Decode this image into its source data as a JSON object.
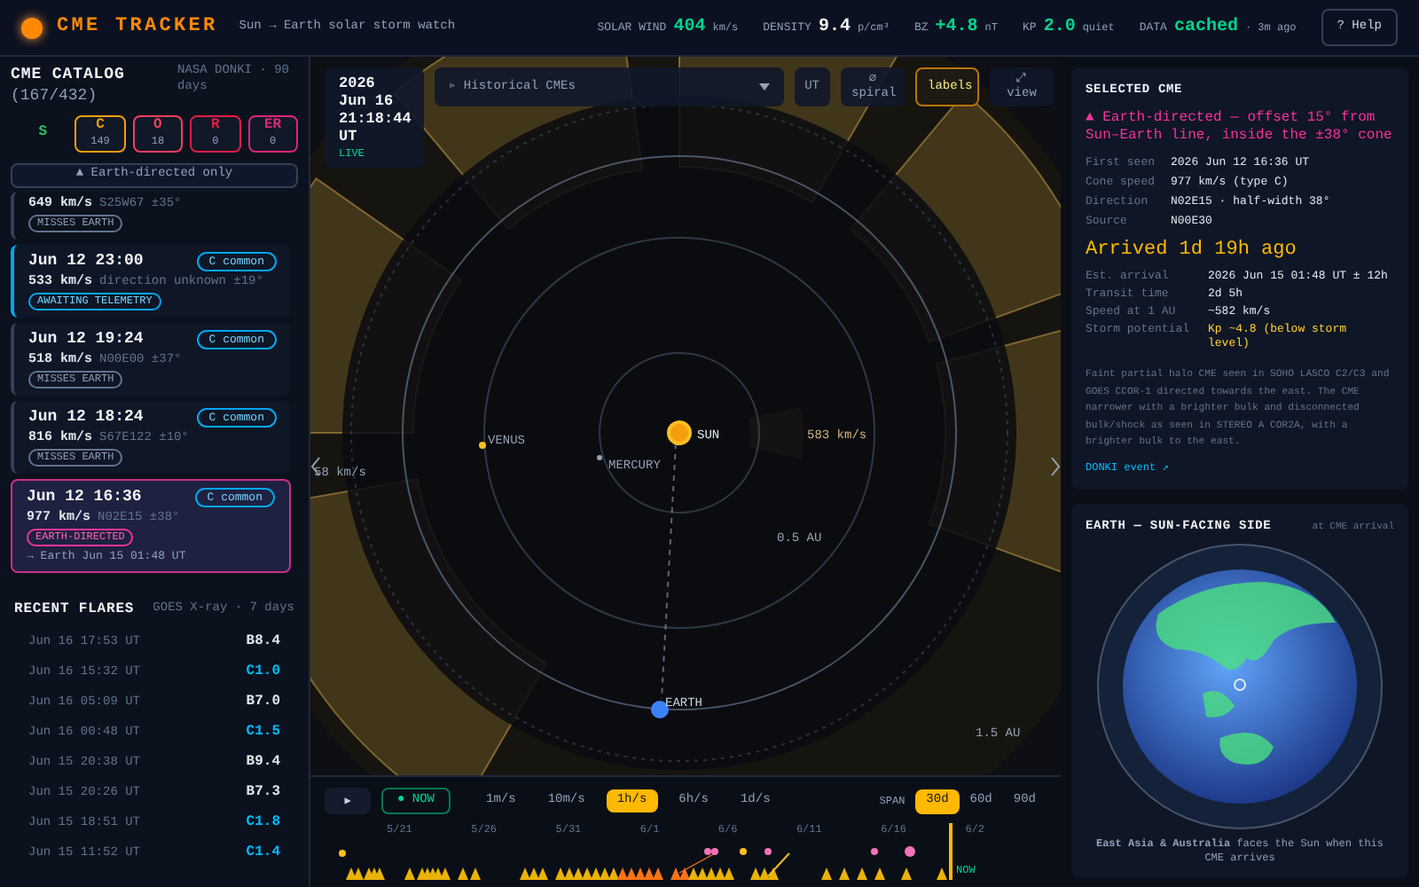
{
  "header": {
    "title": "CME TRACKER",
    "subtitle": "Sun → Earth solar storm watch",
    "stats": [
      {
        "label": "SOLAR WIND",
        "value": "404",
        "unit": "km/s",
        "kind": "good"
      },
      {
        "label": "DENSITY",
        "value": "9.4",
        "unit": "p/cm³",
        "kind": "plain"
      },
      {
        "label": "BZ",
        "value": "+4.8",
        "unit": "nT",
        "kind": "good"
      },
      {
        "label": "KP",
        "value": "2.0",
        "unit": "quiet",
        "kind": "good"
      },
      {
        "label": "DATA",
        "value": "cached",
        "unit": "· 3m ago",
        "kind": "good"
      }
    ],
    "help": "? Help"
  },
  "catalog": {
    "title": "CME CATALOG",
    "count": "(167/432)",
    "source": "NASA DONKI · 90 days",
    "filters": [
      {
        "letter": "S",
        "on": false,
        "color": "#22c55e"
      },
      {
        "letter": "C",
        "count": "149",
        "on": true,
        "color": "#f59e0b"
      },
      {
        "letter": "O",
        "count": "18",
        "on": true,
        "color": "#f43f5e"
      },
      {
        "letter": "R",
        "count": "0",
        "on": true,
        "color": "#e11d48"
      },
      {
        "letter": "ER",
        "count": "0",
        "on": true,
        "color": "#db2777"
      }
    ],
    "earth_only": {
      "label": "▲ Earth-directed only",
      "on": false
    },
    "items": [
      {
        "speed": "649 km/s",
        "direction": "S25W67 ±35°",
        "status": "MISSES EARTH",
        "kind": "misses",
        "selected": false
      },
      {
        "time": "Jun 12 23:00",
        "badge": "C common",
        "speed": "533 km/s",
        "direction": "direction unknown ±19°",
        "status": "AWAITING TELEMETRY",
        "kind": "awaiting",
        "selected": false
      },
      {
        "time": "Jun 12 19:24",
        "badge": "C common",
        "speed": "518 km/s",
        "direction": "N00E00 ±37°",
        "status": "MISSES EARTH",
        "kind": "misses",
        "selected": false
      },
      {
        "time": "Jun 12 18:24",
        "badge": "C common",
        "speed": "816 km/s",
        "direction": "S67E122 ±10°",
        "status": "MISSES EARTH",
        "kind": "misses",
        "selected": false
      },
      {
        "time": "Jun 12 16:36",
        "badge": "C common",
        "speed": "977 km/s",
        "direction": "N02E15 ±38°",
        "status": "EARTH-DIRECTED",
        "kind": "earth",
        "arrival": "→ Earth Jun 15 01:48 UT",
        "selected": true
      }
    ]
  },
  "flares": {
    "title": "RECENT FLARES",
    "source": "GOES X-ray · 7 days",
    "rows": [
      {
        "time": "Jun 16 17:53 UT",
        "class": "B8.4",
        "kind": "b"
      },
      {
        "time": "Jun 16 15:32 UT",
        "class": "C1.0",
        "kind": "c"
      },
      {
        "time": "Jun 16 05:09 UT",
        "class": "B7.0",
        "kind": "b"
      },
      {
        "time": "Jun 16 00:48 UT",
        "class": "C1.5",
        "kind": "c"
      },
      {
        "time": "Jun 15 20:38 UT",
        "class": "B9.4",
        "kind": "b"
      },
      {
        "time": "Jun 15 20:26 UT",
        "class": "B7.3",
        "kind": "b"
      },
      {
        "time": "Jun 15 18:51 UT",
        "class": "C1.8",
        "kind": "c"
      },
      {
        "time": "Jun 15 11:52 UT",
        "class": "C1.4",
        "kind": "c"
      }
    ]
  },
  "view": {
    "clock": "2026 Jun 16 21:18:44 UT",
    "live": "LIVE",
    "layer_select": "▹ Historical CMEs",
    "toggles": [
      {
        "label": "UT",
        "selected": false
      },
      {
        "label": "⌀ spiral",
        "selected": false
      },
      {
        "label": "labels",
        "selected": true
      },
      {
        "label": "⤢ view",
        "selected": false
      }
    ],
    "labels": [
      {
        "text": "SUN",
        "kind": "sun"
      },
      {
        "text": "VENUS",
        "kind": "venus"
      },
      {
        "text": "MERCURY",
        "kind": "mercury"
      },
      {
        "text": "EARTH",
        "kind": "earth"
      },
      {
        "text": "583 km/s",
        "kind": "speed"
      },
      {
        "text": "0.5 AU",
        "kind": "inner"
      },
      {
        "text": "1.5 AU",
        "kind": "outer"
      },
      {
        "text": "58 km/s",
        "kind": "edge"
      }
    ]
  },
  "playback": {
    "play": "▶",
    "now": "● NOW",
    "speeds": [
      {
        "label": "1m/s",
        "selected": false
      },
      {
        "label": "10m/s",
        "selected": false
      },
      {
        "label": "1h/s",
        "selected": true
      },
      {
        "label": "6h/s",
        "selected": false
      },
      {
        "label": "1d/s",
        "selected": false
      }
    ],
    "span_label": "SPAN",
    "spans": [
      {
        "label": "30d",
        "selected": true
      },
      {
        "label": "60d",
        "selected": false
      },
      {
        "label": "90d",
        "selected": false
      }
    ],
    "dates": [
      "5/21",
      "5/26",
      "5/31",
      "6/1",
      "6/6",
      "6/11",
      "6/16",
      "6/2"
    ],
    "now_label": "NOW"
  },
  "selected": {
    "title": "SELECTED CME",
    "alert": "▲ Earth-directed — offset 15° from Sun–Earth line, inside the ±38° cone",
    "facts": [
      {
        "label": "First seen",
        "value": "2026 Jun 12 16:36 UT"
      },
      {
        "label": "Cone speed",
        "value": "977 km/s (type C)"
      },
      {
        "label": "Direction",
        "value": "N02E15 · half-width 38°"
      },
      {
        "label": "Source",
        "value": "N00E30"
      }
    ],
    "arrived": "Arrived 1d 19h ago",
    "forecast": [
      {
        "label": "Est. arrival",
        "value": "2026 Jun 15 01:48 UT ± 12h",
        "kind": "plain"
      },
      {
        "label": "Transit time",
        "value": "2d 5h",
        "kind": "plain"
      },
      {
        "label": "Speed at 1 AU",
        "value": "~582 km/s",
        "kind": "plain"
      },
      {
        "label": "Storm potential",
        "value": "Kp ~4.8 (below storm level)",
        "kind": "warn"
      }
    ],
    "note": "Faint partial halo CME seen in SOHO LASCO C2/C3 and GOES CCOR-1 directed towards the east. The CME narrower with a brighter bulk and disconnected bulk/shock as seen in STEREO A COR2A, with a brighter bulk to the east.",
    "link": "DONKI event ↗"
  },
  "earth": {
    "title": "EARTH — SUN-FACING SIDE",
    "subtitle": "at CME arrival",
    "caption": "**East Asia & Australia** faces the Sun when this CME arrives"
  }
}
